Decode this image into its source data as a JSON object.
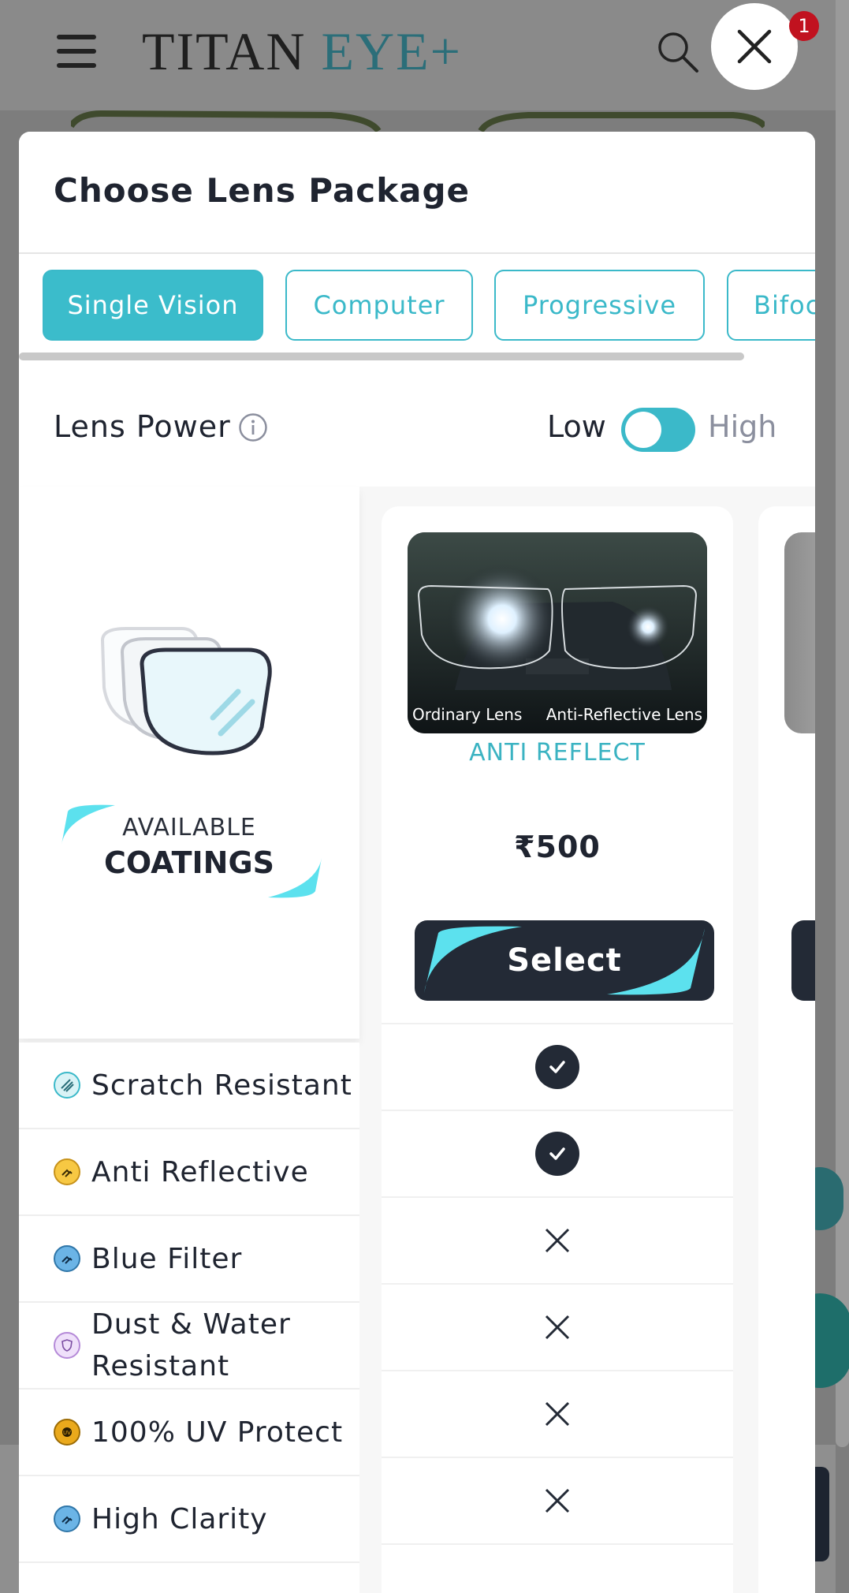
{
  "header": {
    "brand_main": "TITAN",
    "brand_accent": "EYE+",
    "cart_count": "1"
  },
  "modal": {
    "title": "Choose Lens Package",
    "tabs": [
      {
        "label": "Single Vision",
        "active": true
      },
      {
        "label": "Computer",
        "active": false
      },
      {
        "label": "Progressive",
        "active": false
      },
      {
        "label": "Bifoc",
        "active": false
      }
    ],
    "lens_power": {
      "label": "Lens Power",
      "low": "Low",
      "high": "High",
      "toggle_state": "low"
    },
    "coatings_panel": {
      "line1": "AVAILABLE",
      "line2": "COATINGS"
    },
    "features": [
      {
        "label": "Scratch Resistant",
        "icon": "scratch-icon",
        "color": "#3bb9c9"
      },
      {
        "label": "Anti Reflective",
        "icon": "anti-reflective-icon",
        "color": "#f2b830"
      },
      {
        "label": "Blue Filter",
        "icon": "blue-filter-icon",
        "color": "#4a9fd8"
      },
      {
        "label": "Dust & Water Resistant",
        "icon": "shield-icon",
        "color": "#d9b8f0"
      },
      {
        "label": "100% UV Protect",
        "icon": "uv-icon",
        "color": "#e8a619"
      },
      {
        "label": "High Clarity",
        "icon": "clarity-icon",
        "color": "#4a9fd8"
      }
    ],
    "package": {
      "name": "ANTI REFLECT",
      "price": "₹500",
      "select_label": "Select",
      "image_caption_left": "Ordinary Lens",
      "image_caption_right": "Anti-Reflective Lens",
      "marks": [
        "check",
        "check",
        "cross",
        "cross",
        "cross",
        "cross"
      ]
    }
  },
  "colors": {
    "accent": "#3bbccb",
    "dark": "#232a36"
  }
}
